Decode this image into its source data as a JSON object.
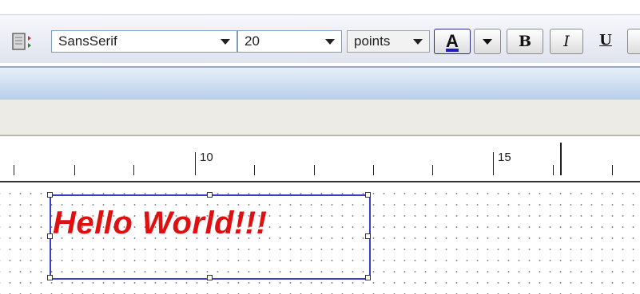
{
  "toolbar": {
    "font_family": {
      "value": "SansSerif"
    },
    "font_size": {
      "value": "20"
    },
    "unit": {
      "value": "points"
    },
    "font_color_glyph": "A",
    "font_color_accent": "#1c1cc0",
    "bold_label": "B",
    "italic_label": "I",
    "underline_label": "U"
  },
  "ruler": {
    "labels": [
      "10",
      "15"
    ]
  },
  "canvas": {
    "text_box": {
      "text": "Hello World!!!",
      "text_color": "#e01010",
      "border_color": "#3c3cc8"
    }
  }
}
